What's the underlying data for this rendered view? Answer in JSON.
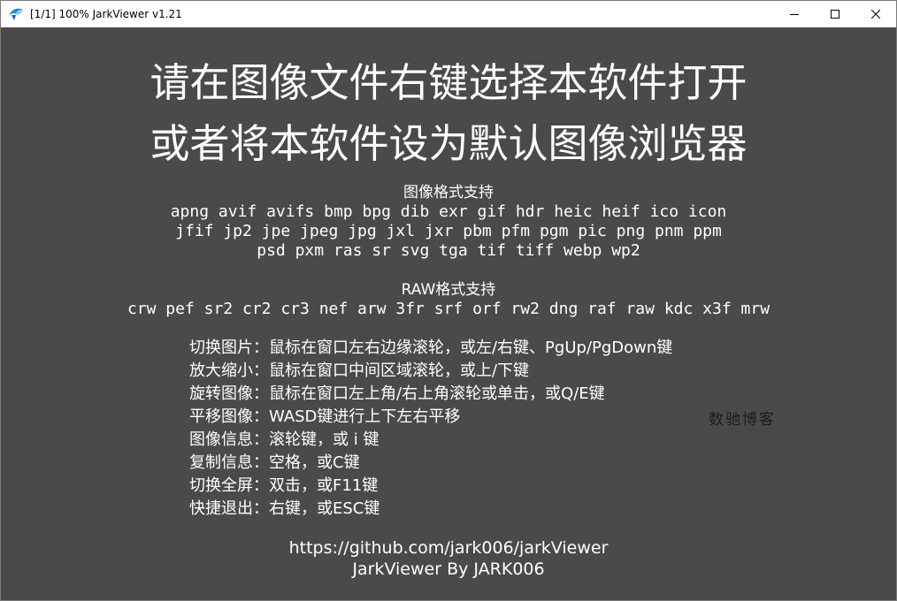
{
  "window": {
    "title": "[1/1] 100% JarkViewer v1.21"
  },
  "colors": {
    "background": "#4a4a4a",
    "text": "#ffffff",
    "titlebar": "#ffffff",
    "watermark": "#1c1c1c"
  },
  "icons": {
    "app": "jarkviewer-bird-icon",
    "minimize": "minimize-icon",
    "maximize": "maximize-icon",
    "close": "close-icon"
  },
  "headline": {
    "line1": "请在图像文件右键选择本软件打开",
    "line2": "或者将本软件设为默认图像浏览器"
  },
  "formats": {
    "heading": "图像格式支持",
    "lines": [
      "apng avif avifs bmp bpg dib exr gif hdr heic heif ico icon",
      "jfif jp2 jpe jpeg jpg jxl jxr pbm pfm pgm pic png pnm ppm",
      "psd pxm ras sr svg tga tif tiff webp wp2"
    ]
  },
  "raw_formats": {
    "heading": "RAW格式支持",
    "line": "crw pef sr2 cr2 cr3 nef arw 3fr srf orf rw2 dng raf raw kdc x3f mrw"
  },
  "help": [
    "切换图片：鼠标在窗口左右边缘滚轮，或左/右键、PgUp/PgDown键",
    "放大缩小：鼠标在窗口中间区域滚轮，或上/下键",
    "旋转图像：鼠标在窗口左上角/右上角滚轮或单击，或Q/E键",
    "平移图像：WASD键进行上下左右平移",
    "图像信息：滚轮键，或 i 键",
    "复制信息：空格，或C键",
    "切换全屏：双击，或F11键",
    "快捷退出：右键，或ESC键"
  ],
  "watermark": "数驰博客",
  "footer": {
    "url": "https://github.com/jark006/jarkViewer",
    "credit": "JarkViewer By JARK006"
  }
}
